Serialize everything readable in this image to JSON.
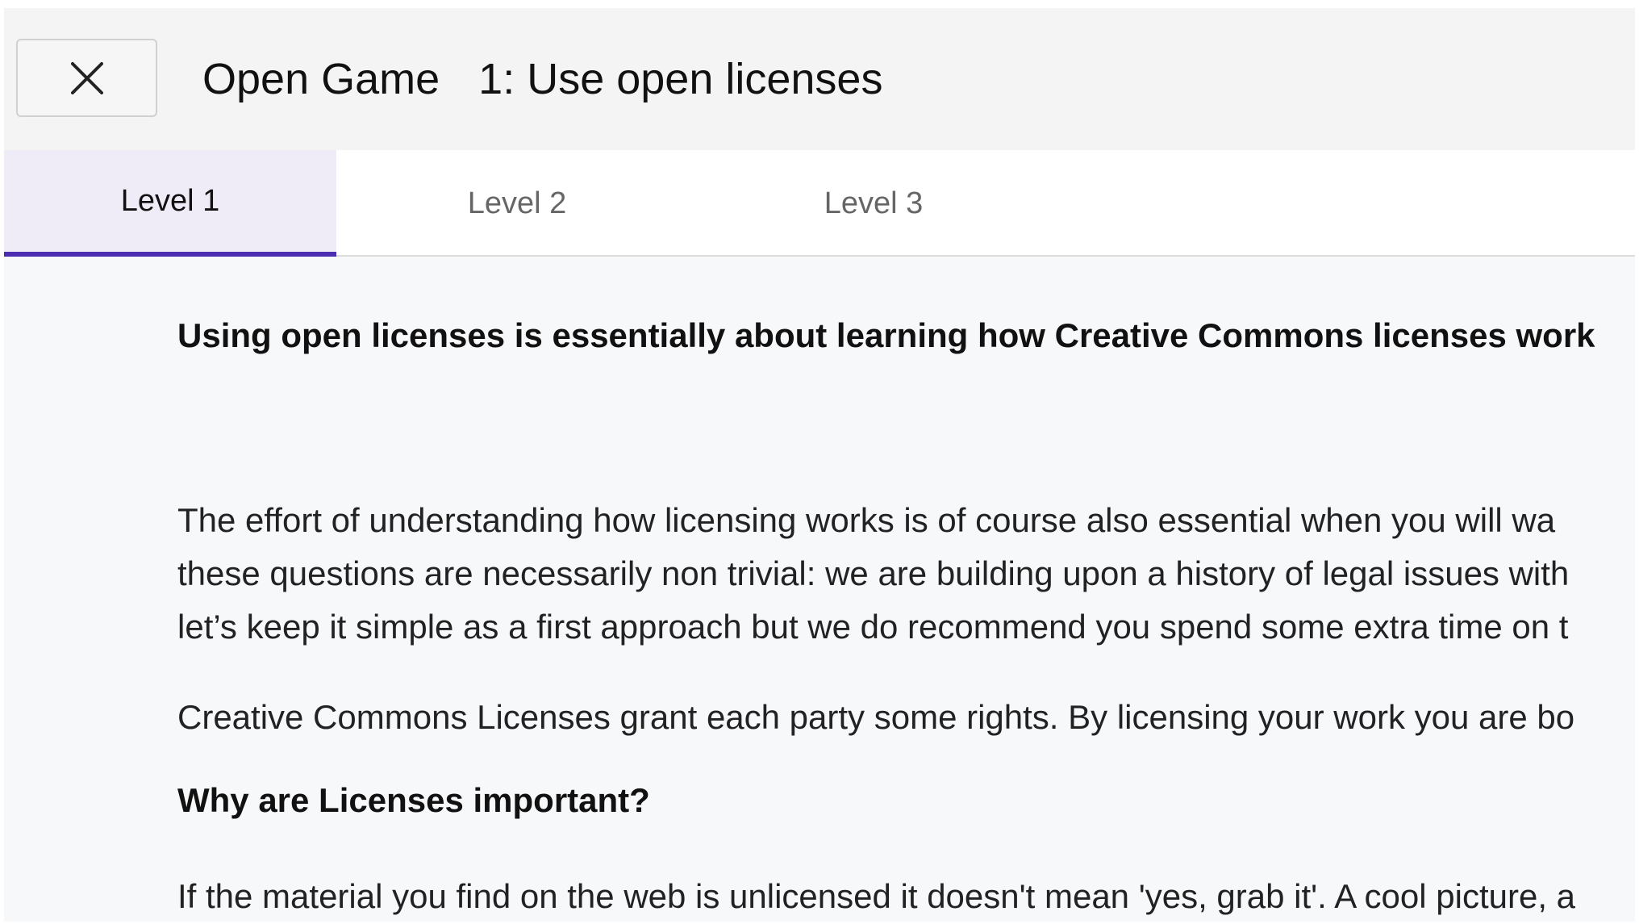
{
  "header": {
    "close_icon": "close-icon",
    "title": "Open Game",
    "subtitle": "1: Use open licenses"
  },
  "tabs": [
    {
      "label": "Level 1",
      "active": true
    },
    {
      "label": "Level 2",
      "active": false
    },
    {
      "label": "Level 3",
      "active": false
    }
  ],
  "content": {
    "heading": "Using open licenses is essentially about learning how Creative Commons licenses work",
    "paragraph1": [
      "The effort of understanding how licensing works is of course also essential when you will wa",
      "these questions are necessarily non trivial: we are building upon a history of legal issues with",
      "let’s keep it simple as a first approach but we do recommend you spend some extra time on t"
    ],
    "paragraph2": "Creative Commons Licenses grant each party some rights. By licensing your work you are bo",
    "heading2": "Why are Licenses important?",
    "paragraph3": "If the material you find on the web is unlicensed it doesn't mean 'yes, grab it'. A cool picture, a"
  },
  "colors": {
    "accent": "#4a2db0",
    "active_tab_bg": "#efecf7",
    "header_bg": "#f4f4f4",
    "content_bg": "#f7f8fa"
  }
}
